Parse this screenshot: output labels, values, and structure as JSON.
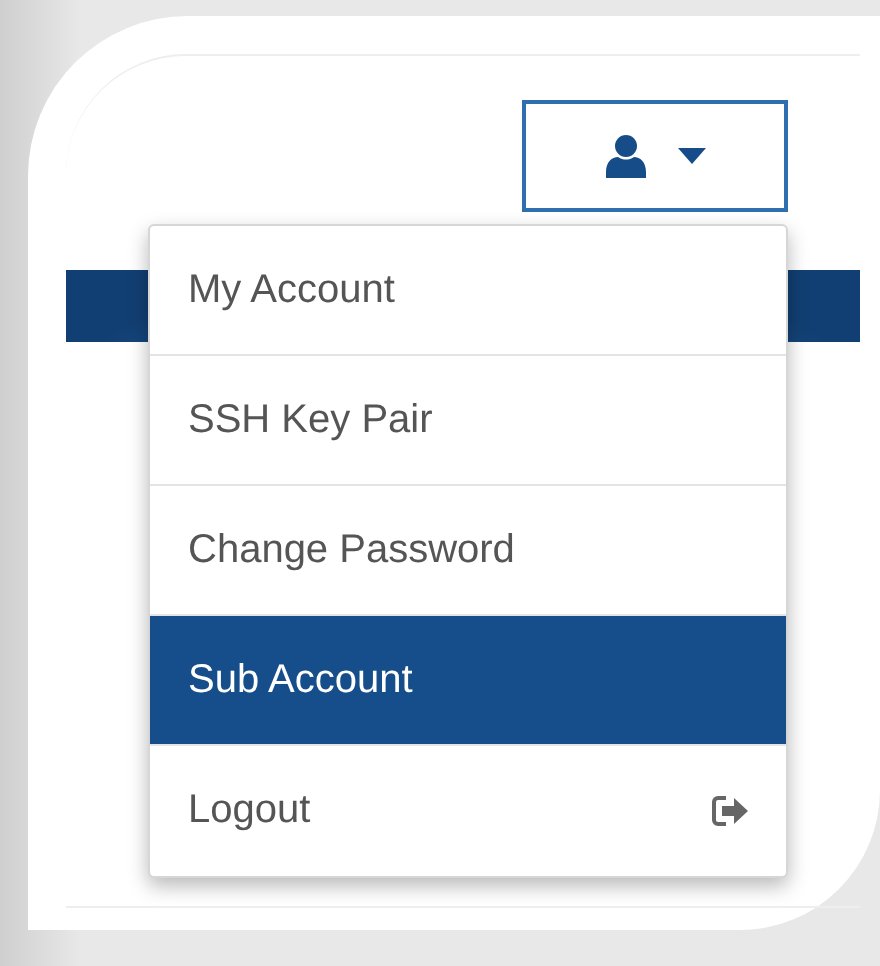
{
  "user_menu": {
    "expanded": true
  },
  "menu_items": [
    {
      "label": "My Account",
      "selected": false,
      "kind": "link"
    },
    {
      "label": "SSH Key Pair",
      "selected": false,
      "kind": "link"
    },
    {
      "label": "Change Password",
      "selected": false,
      "kind": "link"
    },
    {
      "label": "Sub Account",
      "selected": true,
      "kind": "link"
    },
    {
      "label": "Logout",
      "selected": false,
      "kind": "logout"
    }
  ]
}
